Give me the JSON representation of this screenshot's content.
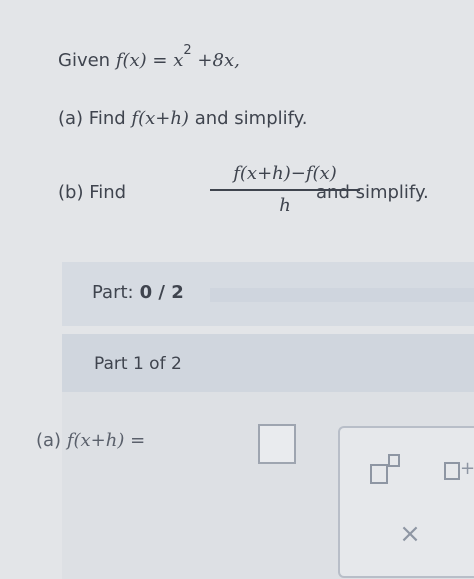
{
  "problem": {
    "given_prefix": "Given",
    "given_lhs": "f(x)",
    "given_equals": "=",
    "given_term1_base": "x",
    "given_term1_exponent": "2",
    "given_rest": "+8x,",
    "part_a_prefix": "(a) Find",
    "part_a_expr": "f(x+h)",
    "part_a_suffix": "and simplify.",
    "part_b_prefix": "(b) Find",
    "part_b_numerator": "f(x+h)−f(x)",
    "part_b_denominator": "h",
    "part_b_suffix": "and simplify."
  },
  "progress": {
    "label": "Part:",
    "value": "0 / 2",
    "completed": 0,
    "total": 2
  },
  "part": {
    "header": "Part 1 of 2",
    "answer_label": "(a)",
    "answer_expr": "f(x+h)",
    "answer_equals": "=",
    "answer_value": ""
  },
  "keypad": {
    "exponent_icon": "box-superscript-icon",
    "plus_icon": "box-plus-icon",
    "plus_glyph": "+",
    "clear_glyph": "×"
  }
}
